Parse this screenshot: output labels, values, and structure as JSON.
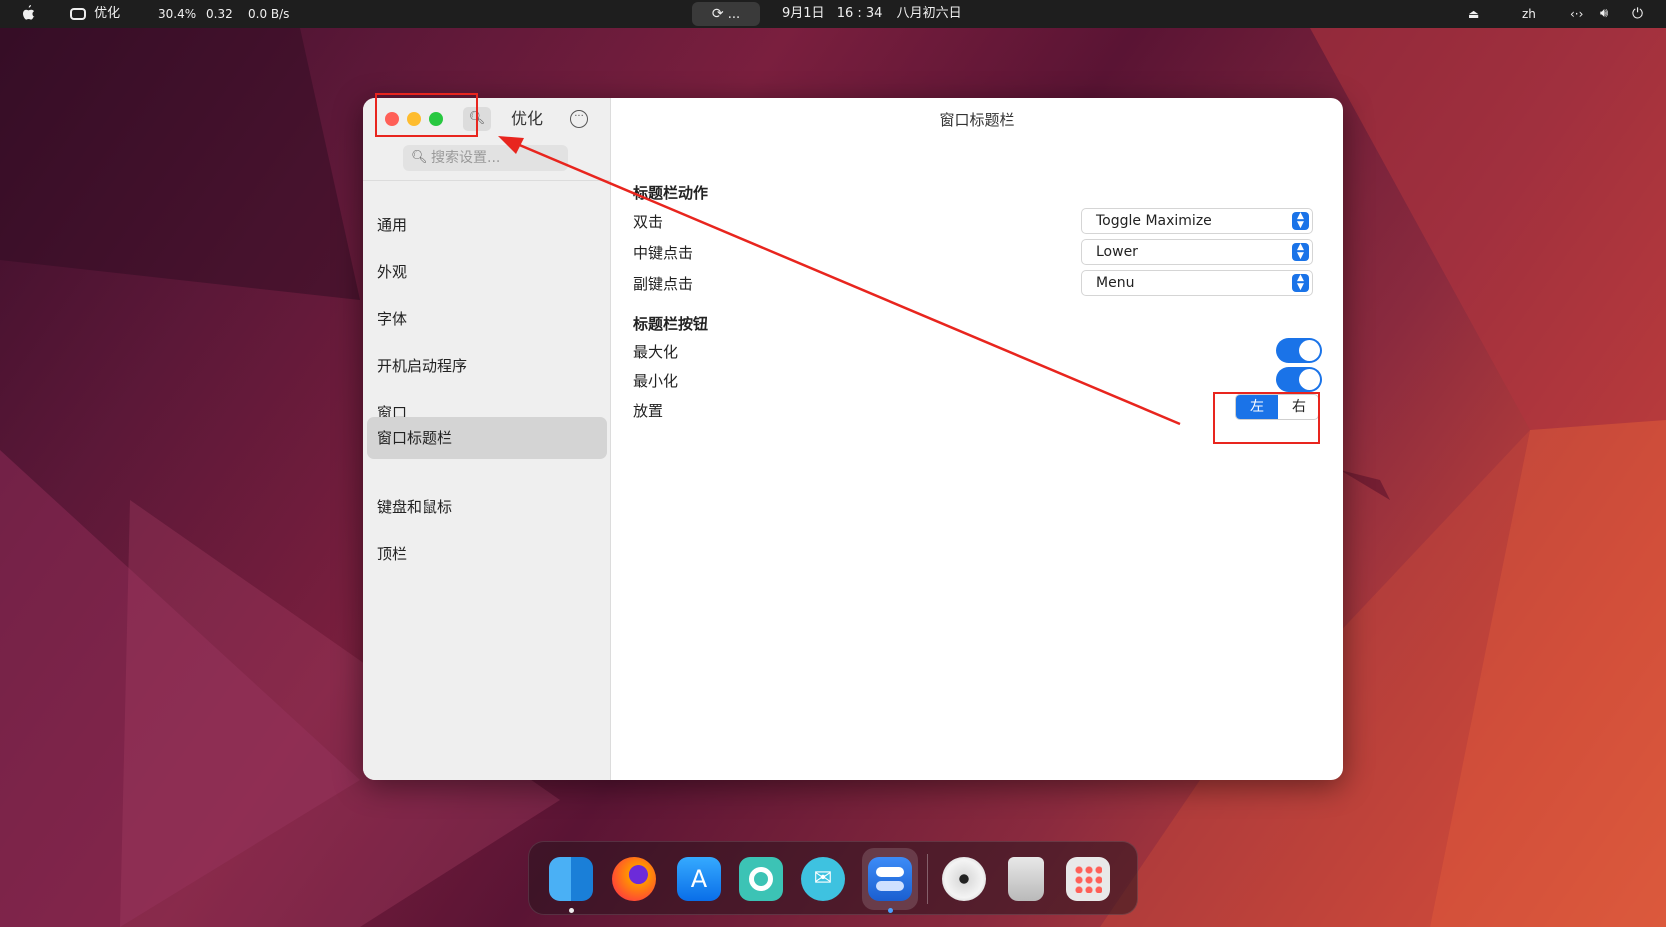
{
  "topbar": {
    "app_name": "优化",
    "cpu": "30.4%",
    "load": "0.32",
    "net": "0.0 B/s",
    "activity_label": "...",
    "date": "9月1日",
    "time": "16 : 34",
    "lunar": "八月初六日",
    "lang": "zh"
  },
  "window": {
    "sidebar_title": "优化",
    "search_placeholder": "搜索设置...",
    "nav": [
      {
        "label": "通用"
      },
      {
        "label": "外观"
      },
      {
        "label": "字体"
      },
      {
        "label": "开机启动程序"
      },
      {
        "label": "窗口"
      },
      {
        "label": "窗口标题栏",
        "active": true
      },
      {
        "label": "键盘和鼠标"
      },
      {
        "label": "顶栏"
      }
    ],
    "content_title": "窗口标题栏",
    "actions_header": "标题栏动作",
    "actions": [
      {
        "label": "双击",
        "value": "Toggle Maximize"
      },
      {
        "label": "中键点击",
        "value": "Lower"
      },
      {
        "label": "副键点击",
        "value": "Menu"
      }
    ],
    "buttons_header": "标题栏按钮",
    "maximize_label": "最大化",
    "maximize_on": true,
    "minimize_label": "最小化",
    "minimize_on": true,
    "placement_label": "放置",
    "placement_left": "左",
    "placement_right": "右",
    "placement_selected": "左"
  },
  "colors": {
    "accent": "#1a73e8",
    "annotation": "#e8251e",
    "close": "#ff5f57",
    "minimize": "#febc2e",
    "maximize": "#28c840"
  },
  "dock": {
    "apps": [
      "finder-icon",
      "firefox-icon",
      "app-store-icon",
      "help-icon",
      "mail-icon",
      "tweaks-icon",
      "disc-icon",
      "trash-icon",
      "app-grid-icon"
    ]
  }
}
